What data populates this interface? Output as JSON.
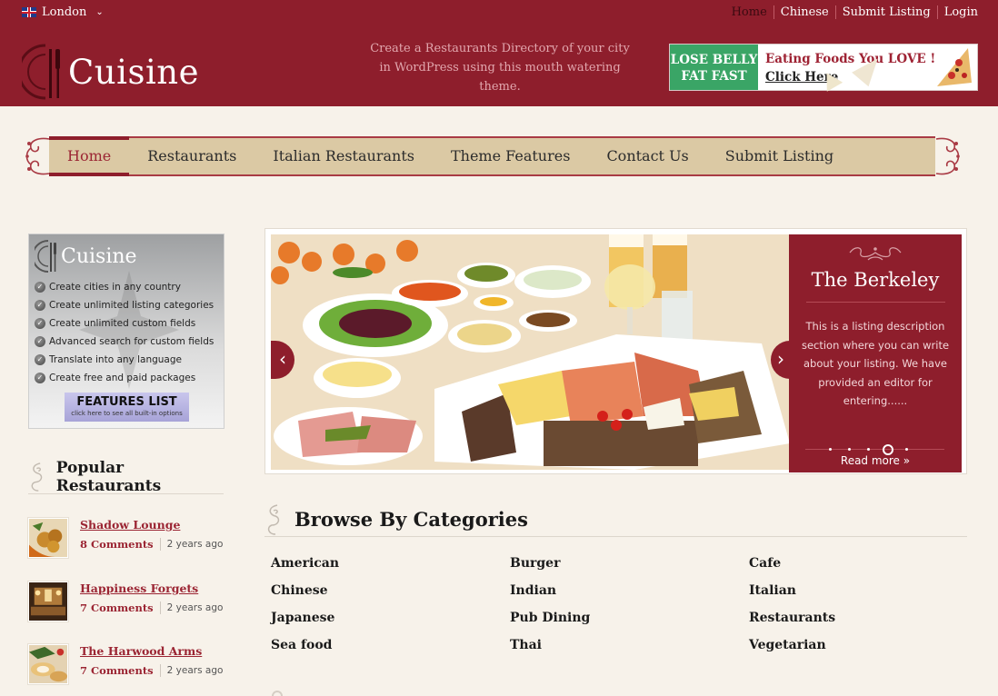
{
  "header": {
    "city": "London",
    "city_icon": "uk-flag-icon",
    "top_links": [
      "Home",
      "Chinese",
      "Submit Listing",
      "Login"
    ],
    "logo_text": "Cuisine",
    "tagline": "Create a Restaurants Directory of your city in WordPress using this mouth watering theme.",
    "ad": {
      "left_line1": "LOSE BELLY",
      "left_line2": "FAT FAST",
      "headline": "Eating Foods You LOVE !",
      "link": "Click Here"
    }
  },
  "nav": {
    "items": [
      "Home",
      "Restaurants",
      "Italian Restaurants",
      "Theme Features",
      "Contact Us",
      "Submit Listing"
    ],
    "active": "Home"
  },
  "promo": {
    "title": "Cuisine",
    "features": [
      "Create cities in any country",
      "Create unlimited listing categories",
      "Create unlimited custom fields",
      "Advanced search for custom fields",
      "Translate into any language",
      "Create free and paid packages"
    ],
    "button_title": "FEATURES LIST",
    "button_sub": "click here to see all built-in options"
  },
  "popular": {
    "title": "Popular Restaurants",
    "items": [
      {
        "name": "Shadow Lounge",
        "comments": "8 Comments",
        "time": "2 years ago"
      },
      {
        "name": "Happiness Forgets",
        "comments": "7 Comments",
        "time": "2 years ago"
      },
      {
        "name": "The Harwood Arms",
        "comments": "7 Comments",
        "time": "2 years ago"
      }
    ]
  },
  "slider": {
    "title": "The Berkeley",
    "description": "This is a listing description section where you can write about your listing. We have provided an editor for entering......",
    "read_more": "Read more »",
    "prev": "‹",
    "next": "›",
    "slide_count": 5,
    "active_slide": 4
  },
  "categories": {
    "title": "Browse By Categories",
    "items": [
      "American",
      "Burger",
      "Cafe",
      "Chinese",
      "Indian",
      "Italian",
      "Japanese",
      "Pub Dining",
      "Restaurants",
      "Sea food",
      "Thai",
      "Vegetarian"
    ]
  },
  "colors": {
    "brand": "#8e1e2c",
    "nav_bg": "#dbc9a4",
    "page_bg": "#f7f2ea",
    "ad_green": "#3aa566"
  }
}
